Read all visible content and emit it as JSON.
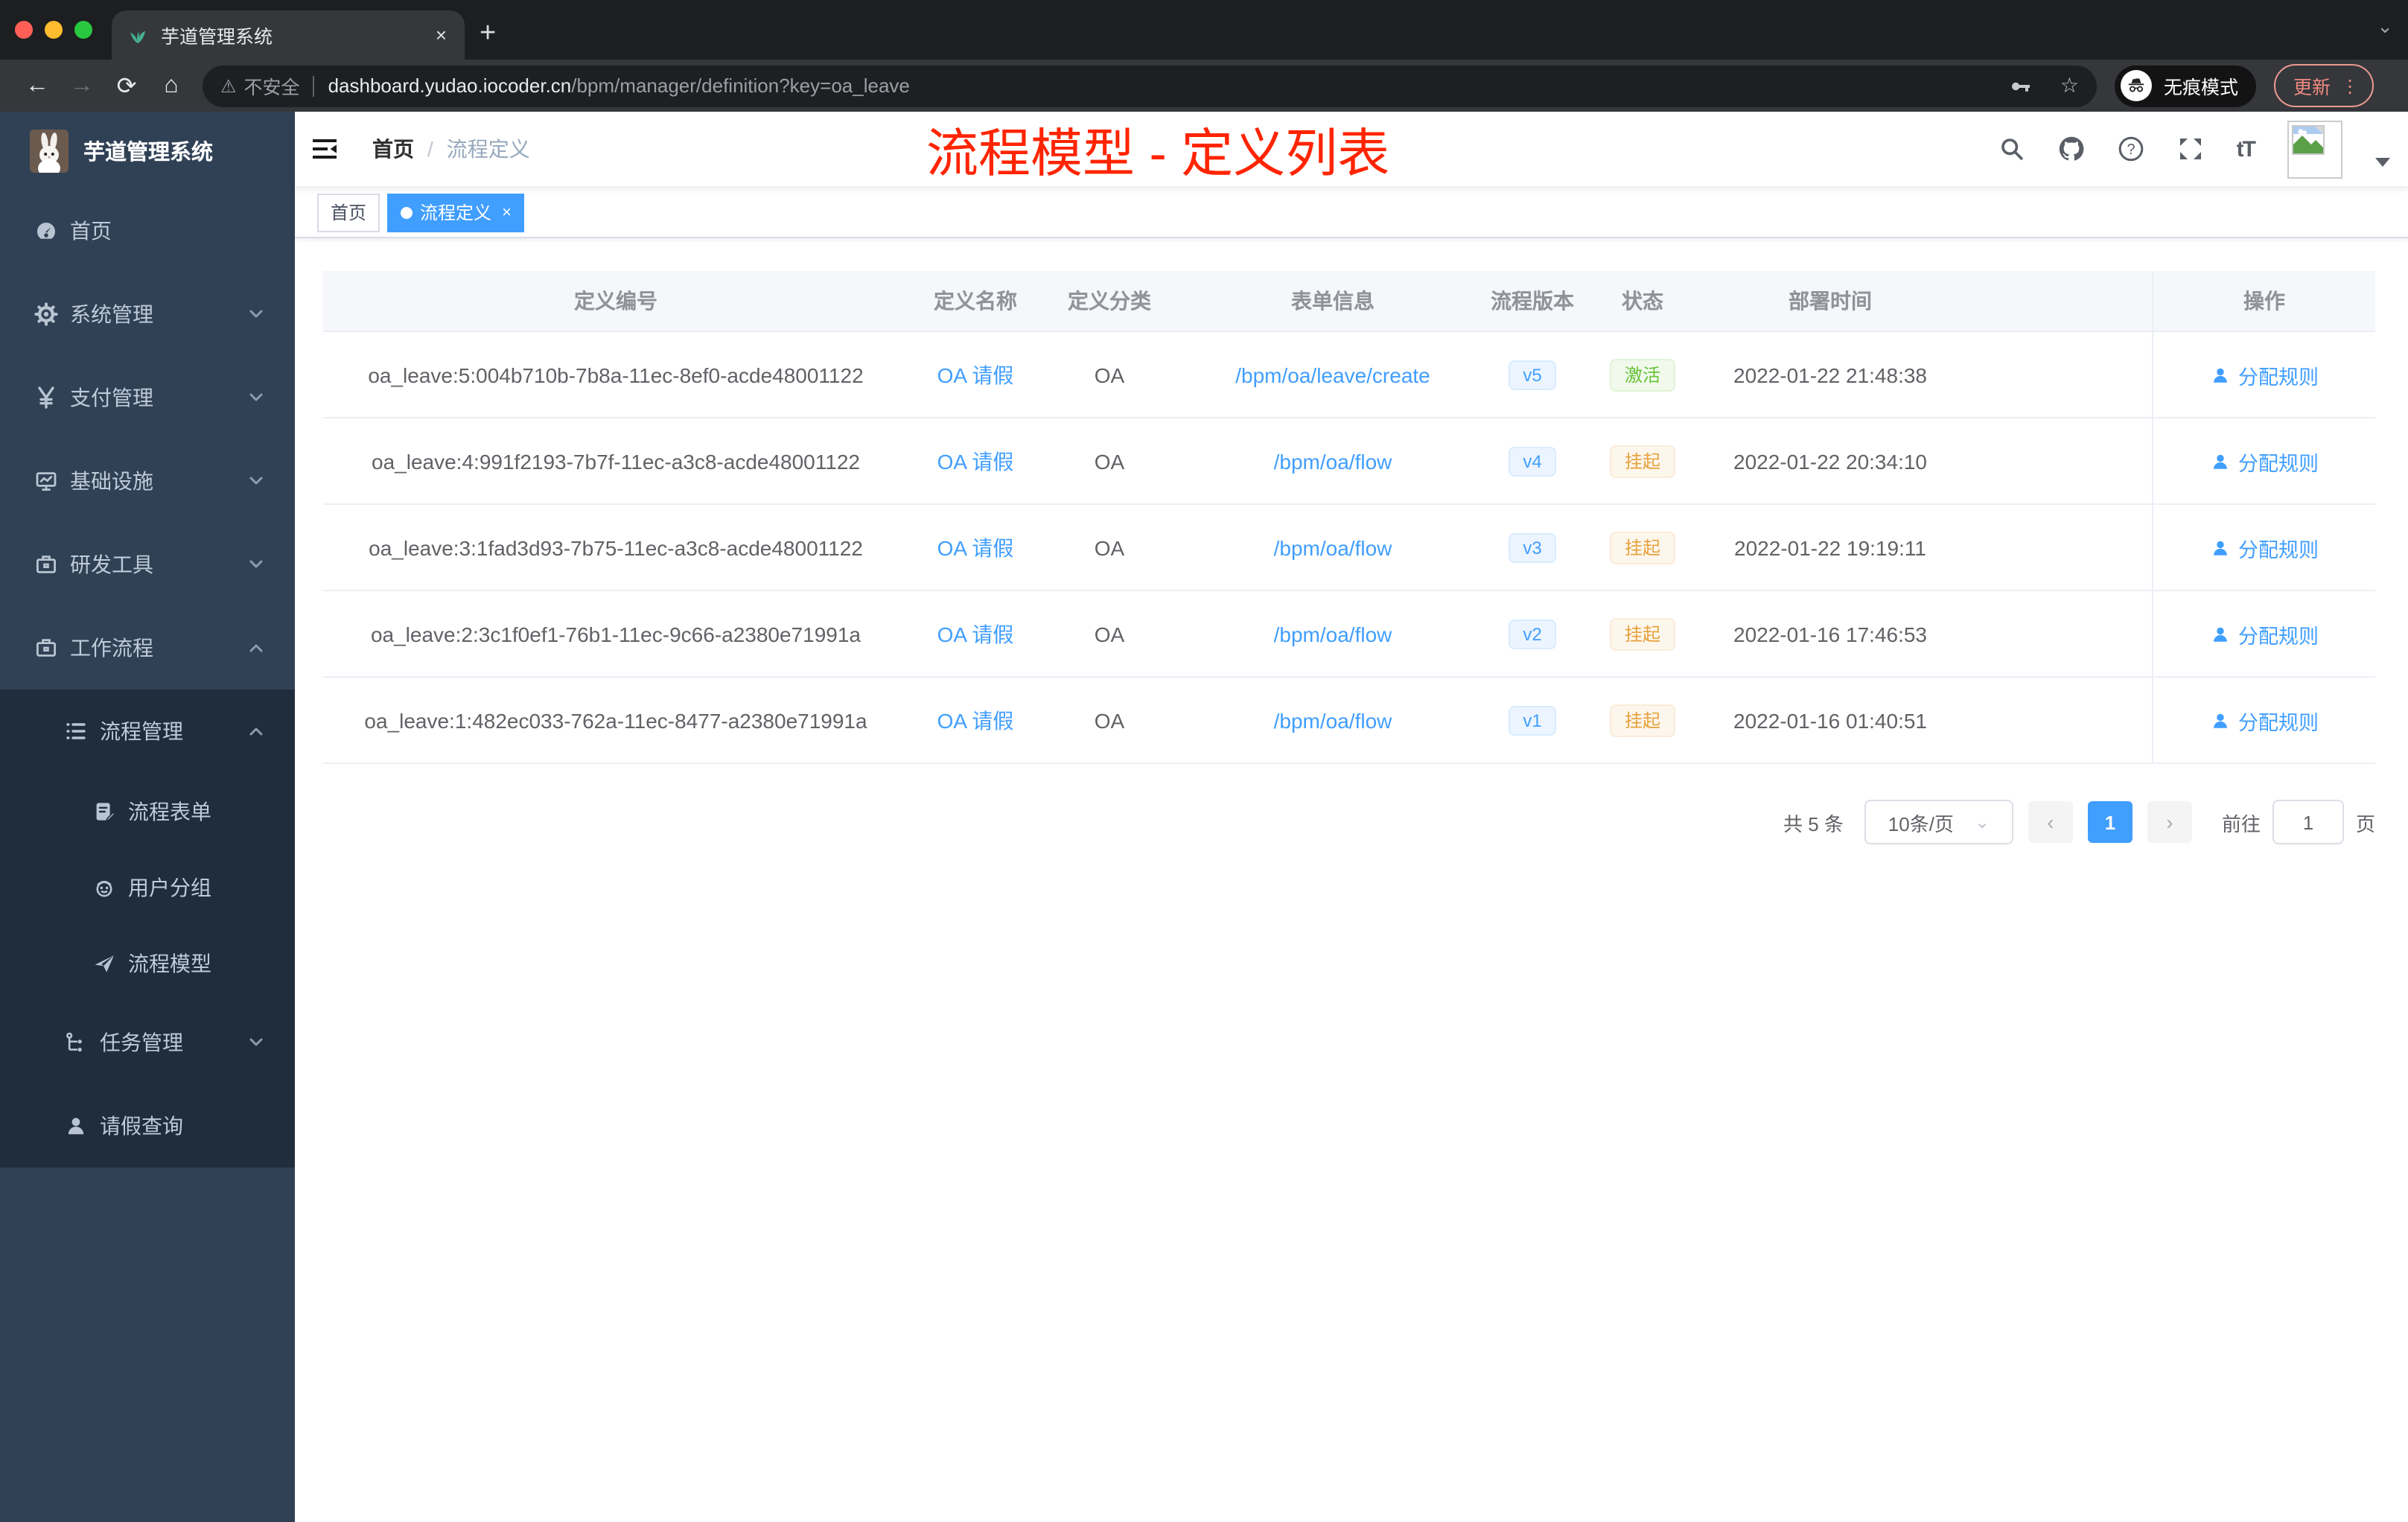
{
  "colors": {
    "accent": "#409eff",
    "success": "#67c23a",
    "warning": "#e6a23c",
    "annotation_red": "#ff2400",
    "sidebar_bg": "#304156",
    "submenu_bg": "#1f2d3d",
    "tab_active": "#409eff",
    "traffic_lights": [
      "#ff5f57",
      "#febc2e",
      "#28c840"
    ]
  },
  "browser": {
    "tab_title": "芋道管理系统",
    "url": {
      "warning_label": "不安全",
      "host": "dashboard.yudao.iocoder.cn",
      "path": "/bpm/manager/definition?key=oa_leave"
    },
    "incognito_label": "无痕模式",
    "update_label": "更新"
  },
  "glyphs": {
    "tab_close": "×",
    "new_tab": "+",
    "strip_caret": "⌄",
    "back": "←",
    "forward": "→",
    "reload": "⟳",
    "home": "⌂",
    "warning_triangle": "⚠",
    "bookmark_star": "☆",
    "menu_dots": "⋮",
    "font_size_label": "tT",
    "dropdown_caret": "⌄",
    "prev_arrow": "‹",
    "next_arrow": "›",
    "tag_close": "×"
  },
  "sidebar": {
    "title": "芋道管理系统",
    "menu": [
      {
        "label": "首页",
        "icon": "#dashboard-icon",
        "level": "1",
        "chevron": "",
        "sub": "false"
      },
      {
        "label": "系统管理",
        "icon": "#gear-icon",
        "level": "1",
        "chevron": "down",
        "sub": "false"
      },
      {
        "label": "支付管理",
        "icon": "#yen-icon",
        "level": "1",
        "chevron": "down",
        "sub": "false"
      },
      {
        "label": "基础设施",
        "icon": "#monitor-icon",
        "level": "1",
        "chevron": "down",
        "sub": "false"
      },
      {
        "label": "研发工具",
        "icon": "#toolbox-icon",
        "level": "1",
        "chevron": "down",
        "sub": "false"
      },
      {
        "label": "工作流程",
        "icon": "#briefcase-icon",
        "level": "1",
        "chevron": "up",
        "sub": "false"
      },
      {
        "label": "流程管理",
        "icon": "#list-tree-icon",
        "level": "2",
        "chevron": "up",
        "sub": "true"
      },
      {
        "label": "流程表单",
        "icon": "#doc-edit-icon",
        "level": "3",
        "chevron": "",
        "sub": "true"
      },
      {
        "label": "用户分组",
        "icon": "#robot-icon",
        "level": "3",
        "chevron": "",
        "sub": "true"
      },
      {
        "label": "流程模型",
        "icon": "#paper-plane-icon",
        "level": "3",
        "chevron": "",
        "sub": "true"
      },
      {
        "label": "任务管理",
        "icon": "#flow-icon",
        "level": "2",
        "chevron": "down",
        "sub": "true"
      },
      {
        "label": "请假查询",
        "icon": "#person-icon",
        "level": "2",
        "chevron": "",
        "sub": "true"
      }
    ]
  },
  "header": {
    "breadcrumb_first": "首页",
    "breadcrumb_separator": "/",
    "breadcrumb_last": "流程定义"
  },
  "annotation": {
    "text": "流程模型 - 定义列表",
    "color": "#ff2400"
  },
  "tags": [
    {
      "label": "首页",
      "active": "false",
      "closable": "false"
    },
    {
      "label": "流程定义",
      "active": "true",
      "closable": "true"
    }
  ],
  "table": {
    "columns": [
      "定义编号",
      "定义名称",
      "定义分类",
      "表单信息",
      "流程版本",
      "状态",
      "部署时间",
      "操作"
    ],
    "rows": [
      {
        "id": "oa_leave:5:004b710b-7b8a-11ec-8ef0-acde48001122",
        "name": "OA 请假",
        "category": "OA",
        "form": "/bpm/oa/leave/create",
        "version": "v5",
        "status": {
          "label": "激活",
          "variant": "success"
        },
        "deployed": "2022-01-22 21:48:38",
        "action": "分配规则"
      },
      {
        "id": "oa_leave:4:991f2193-7b7f-11ec-a3c8-acde48001122",
        "name": "OA 请假",
        "category": "OA",
        "form": "/bpm/oa/flow",
        "version": "v4",
        "status": {
          "label": "挂起",
          "variant": "warning"
        },
        "deployed": "2022-01-22 20:34:10",
        "action": "分配规则"
      },
      {
        "id": "oa_leave:3:1fad3d93-7b75-11ec-a3c8-acde48001122",
        "name": "OA 请假",
        "category": "OA",
        "form": "/bpm/oa/flow",
        "version": "v3",
        "status": {
          "label": "挂起",
          "variant": "warning"
        },
        "deployed": "2022-01-22 19:19:11",
        "action": "分配规则"
      },
      {
        "id": "oa_leave:2:3c1f0ef1-76b1-11ec-9c66-a2380e71991a",
        "name": "OA 请假",
        "category": "OA",
        "form": "/bpm/oa/flow",
        "version": "v2",
        "status": {
          "label": "挂起",
          "variant": "warning"
        },
        "deployed": "2022-01-16 17:46:53",
        "action": "分配规则"
      },
      {
        "id": "oa_leave:1:482ec033-762a-11ec-8477-a2380e71991a",
        "name": "OA 请假",
        "category": "OA",
        "form": "/bpm/oa/flow",
        "version": "v1",
        "status": {
          "label": "挂起",
          "variant": "warning"
        },
        "deployed": "2022-01-16 01:40:51",
        "action": "分配规则"
      }
    ]
  },
  "pagination": {
    "total": "共 5 条",
    "page_size": "10条/页",
    "current_page": "1",
    "goto_label": "前往",
    "goto_value": "1",
    "goto_suffix": "页"
  }
}
